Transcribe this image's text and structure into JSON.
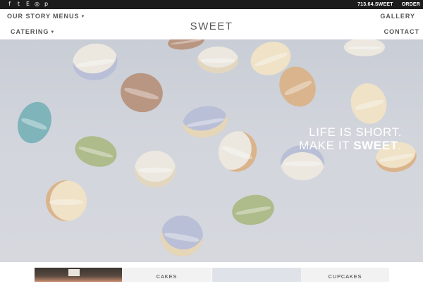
{
  "topbar": {
    "social_icons": [
      "facebook-icon",
      "twitter-icon",
      "yelp-icon",
      "instagram-icon",
      "pinterest-icon"
    ],
    "social_glyphs": [
      "f",
      "t",
      "E",
      "◎",
      "p"
    ],
    "phone": "713.64.SWEET",
    "order_label": "ORDER"
  },
  "header": {
    "brand": "SWEET",
    "nav_left": {
      "our_story": "OUR STORY",
      "menus": "MENUS",
      "catering": "CATERING"
    },
    "nav_right": {
      "gallery": "GALLERY",
      "contact": "CONTACT"
    },
    "caret": "▼"
  },
  "hero": {
    "tagline_line1": "LIFE IS SHORT.",
    "tagline_line2_prefix": "MAKE IT ",
    "tagline_line2_bold": "SWEET",
    "tagline_line2_suffix": ".",
    "macaron_colors": {
      "white": "#ece8df",
      "lavender": "#b9bfd6",
      "mocha": "#b89682",
      "teal": "#7fb4bb",
      "pistachio": "#aebb8a",
      "cream": "#efe2c7",
      "peach": "#d9b48c"
    }
  },
  "tiles": {
    "cakes": "CAKES",
    "cupcakes": "CUPCAKES"
  },
  "colors": {
    "topbar_bg": "#1c1c1c",
    "hero_bg": "#d2d5dc",
    "tile_bg": "#f2f2f2"
  }
}
